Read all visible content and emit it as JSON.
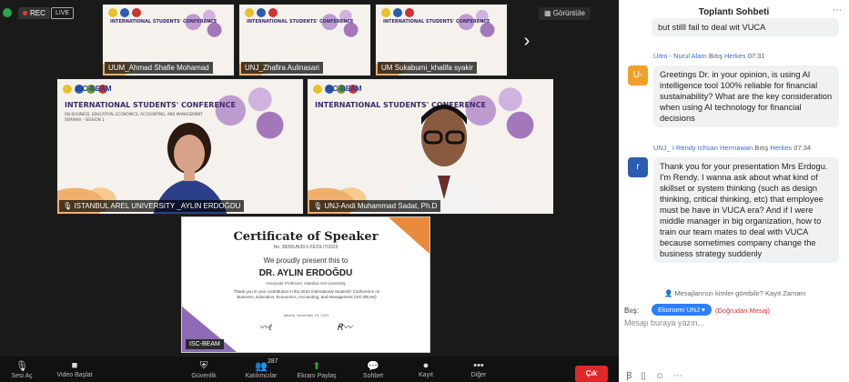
{
  "topbar": {
    "rec_label": "REC",
    "live_label": "LIVE",
    "view_label": "Görüntüle"
  },
  "thumbnails": [
    {
      "name": "UUM_Ahmad Shafie Mohamad"
    },
    {
      "name": "UNJ_Zhafira Aulinasari"
    },
    {
      "name": "UM Sukabumi_khalifa syakir"
    }
  ],
  "conference": {
    "banner_logo": "ISC-BEAM",
    "title": "INTERNATIONAL STUDENTS' CONFERENCE",
    "subtitle": "ON BUSINESS, EDUCATION, ECONOMICS, ACCOUNTING, AND MANAGEMENT",
    "session": "SEMINAR - SESSION 1"
  },
  "speakers": [
    {
      "name": "ISTANBUL AREL UNIVERSITY _AYLIN ERDOĞDU"
    },
    {
      "name": "UNJ-Andi Muhammad Sadat, Ph.D"
    }
  ],
  "certificate": {
    "title": "Certificate of Speaker",
    "number": "No. 3828/UN39.5.FE/DL/7/2023",
    "present": "We proudly present this to",
    "name": "DR. AYLIN ERDOĞDU",
    "role": "Associate Professor, Istanbul Arel University",
    "body": "Thank you in your contribution in the 2023 International Students' Conference on Business, Education, Economics, Accounting, and Management (ISC-BEAM)",
    "date": "Jakarta, November 18, 2023",
    "logo": "ISC-BEAM"
  },
  "toolbar": {
    "items": [
      {
        "label": "Sesi Aç",
        "icon": "microphone-icon"
      },
      {
        "label": "Video Başlat",
        "icon": "video-icon"
      },
      {
        "label": "Güvenlik",
        "icon": "shield-icon"
      },
      {
        "label": "Katılımcılar",
        "icon": "participants-icon",
        "count": "287"
      },
      {
        "label": "Ekranı Paylaş",
        "icon": "share-screen-icon"
      },
      {
        "label": "Sohbet",
        "icon": "chat-icon"
      },
      {
        "label": "Kayıt",
        "icon": "record-icon"
      },
      {
        "label": "Diğer",
        "icon": "more-icon"
      }
    ],
    "exit_label": "Çık"
  },
  "chat": {
    "title": "Toplantı Sohbeti",
    "messages": [
      {
        "text": "but stilll fail to deal wit VUCA"
      },
      {
        "sender": "Uitm - Nurul Alam",
        "to_prefix": "Bıtış",
        "to": "Herkes",
        "time": "07:31",
        "avatar_letter": "U-",
        "avatar_color": "#f0a028",
        "text": "Greetings Dr. in your opinion, is using AI intelligence tool 100% reliable for financial sustainability? What are the key consideration when using AI technology for financial decisions"
      },
      {
        "sender": "UNJ_ I Rendy Ichsan Hermawan",
        "to_prefix": "Bıtış",
        "to": "Herkes",
        "time": "07:34",
        "avatar_letter": "r",
        "avatar_color": "#2a5db0",
        "text": "Thank you for your presentation Mrs Erdogu. I'm Rendy. I wanna ask about what kind of skillset or system thinking (such as design thinking, critical thinking, etc) that employee must be have in VUCA era? And if I were middle manager in big organization, how to train our team mates to deal with VUCA because sometimes company change the business strategy suddenly"
      }
    ],
    "notice": "Mesajlarınızı kimler görebilir? Kayıt Zamanı",
    "to_label": "Bıış:",
    "to_value": "Ekonomi UNJ",
    "dm_label": "(Doğrudan Mesaj)",
    "input_placeholder": "Mesajı buraya yazın..."
  }
}
